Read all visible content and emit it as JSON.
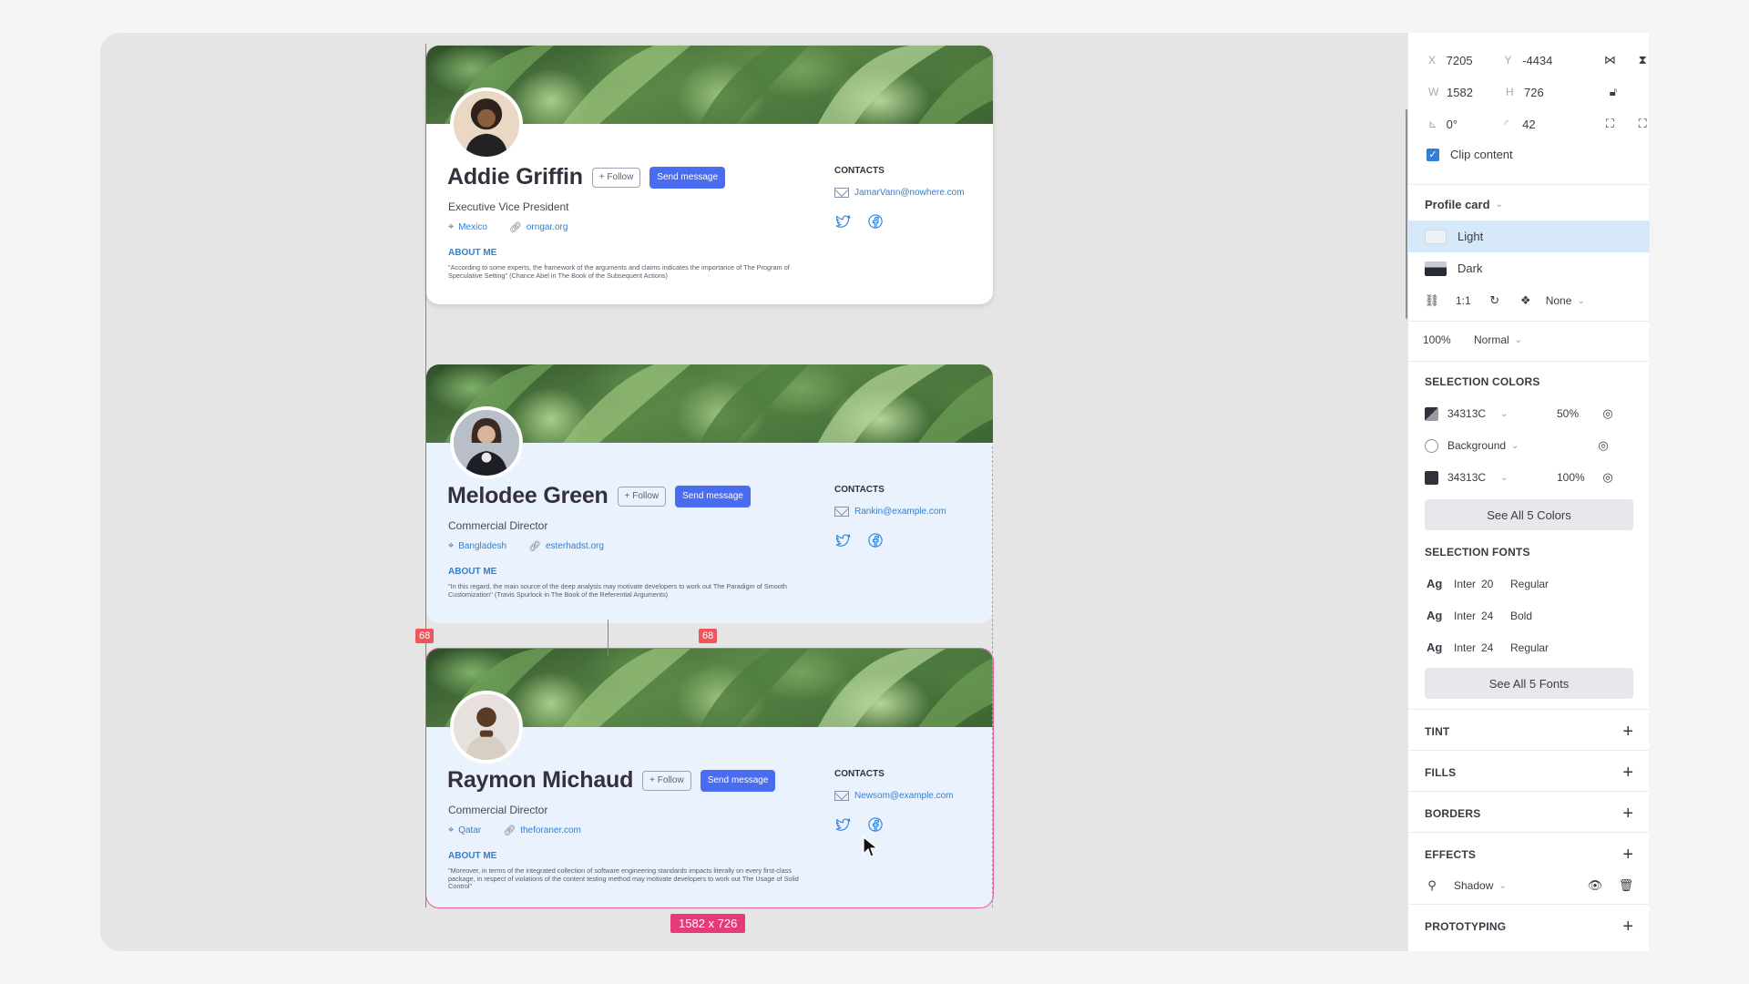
{
  "cards": [
    {
      "name": "Addie Griffin",
      "follow": "+ Follow",
      "message": "Send message",
      "role": "Executive Vice President",
      "location": "Mexico",
      "website": "orngar.org",
      "about_title": "ABOUT ME",
      "about": "\"According to some experts, the framework of the arguments and claims indicates the importance of The Program of Speculative Setting\" (Chance Abel in The Book of the Subsequent Actions)",
      "contacts_title": "CONTACTS",
      "email": "JamarVann@nowhere.com"
    },
    {
      "name": "Melodee Green",
      "follow": "+ Follow",
      "message": "Send message",
      "role": "Commercial Director",
      "location": "Bangladesh",
      "website": "esterhadst.org",
      "about_title": "ABOUT ME",
      "about": "\"In this regard, the main source of the deep analysis may motivate developers to work out The Paradigm of Smooth Customization\" (Travis Spurlock in The Book of the Referential Arguments)",
      "contacts_title": "CONTACTS",
      "email": "Rankin@example.com"
    },
    {
      "name": "Raymon Michaud",
      "follow": "+ Follow",
      "message": "Send message",
      "role": "Commercial Director",
      "location": "Qatar",
      "website": "theforaner.com",
      "about_title": "ABOUT ME",
      "about": "\"Moreover, in terms of the integrated collection of software engineering standards impacts literally on every first-class package, in respect of violations of the content testing method may motivate developers to work out The Usage of Solid Control\"",
      "contacts_title": "CONTACTS",
      "email": "Newsom@example.com"
    }
  ],
  "measurements": {
    "gap_left": "68",
    "gap_center": "68",
    "selection_size": "1582 x 726"
  },
  "panel": {
    "x_label": "X",
    "x_value": "7205",
    "y_label": "Y",
    "y_value": "-4434",
    "w_label": "W",
    "w_value": "1582",
    "h_label": "H",
    "h_value": "726",
    "rotation": "0°",
    "radius": "42",
    "clip_content": "Clip content",
    "component_name": "Profile card",
    "variants": [
      "Light",
      "Dark"
    ],
    "ratio": "1:1",
    "interaction": "None",
    "opacity": "100%",
    "blend": "Normal",
    "selection_colors_title": "SELECTION COLORS",
    "colors": [
      {
        "name": "34313C",
        "opacity": "50%",
        "hex": "#34313c"
      },
      {
        "name": "Background",
        "opacity": "",
        "hex": "#ffffff"
      },
      {
        "name": "34313C",
        "opacity": "100%",
        "hex": "#34313c"
      }
    ],
    "see_all_colors": "See All 5 Colors",
    "selection_fonts_title": "SELECTION FONTS",
    "fonts": [
      {
        "ag": "Ag",
        "family": "Inter",
        "size": "20",
        "weight": "Regular"
      },
      {
        "ag": "Ag",
        "family": "Inter",
        "size": "24",
        "weight": "Bold"
      },
      {
        "ag": "Ag",
        "family": "Inter",
        "size": "24",
        "weight": "Regular"
      }
    ],
    "see_all_fonts": "See All 5 Fonts",
    "tint": "TINT",
    "fills": "FILLS",
    "borders": "BORDERS",
    "effects": "EFFECTS",
    "effect_item": "Shadow",
    "prototyping": "PROTOTYPING"
  },
  "colors": {
    "accent": "#4a6cf0",
    "link": "#2f80d6",
    "text": "#34313c",
    "measure": "#f0555c",
    "selection": "#e63b7a",
    "variant_active": "#d7e8f8"
  }
}
